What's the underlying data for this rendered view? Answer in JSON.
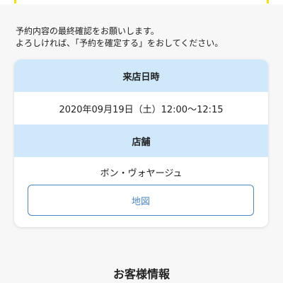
{
  "intro": {
    "line1": "予約内容の最終確認をお願いします。",
    "line2": "よろしければ、「予約を確定する」をおしてください。"
  },
  "reservation": {
    "datetime_label": "来店日時",
    "datetime_value": "2020年09月19日（土）12:00〜12:15",
    "store_label": "店舗",
    "store_value": "ボン・ヴォヤージュ",
    "map_button": "地図"
  },
  "customer_section": {
    "title": "お客様情報"
  },
  "colors": {
    "accent_blue": "#4a86c8",
    "header_bg": "#cfe8fa",
    "yellow_mark": "#f2e300"
  }
}
